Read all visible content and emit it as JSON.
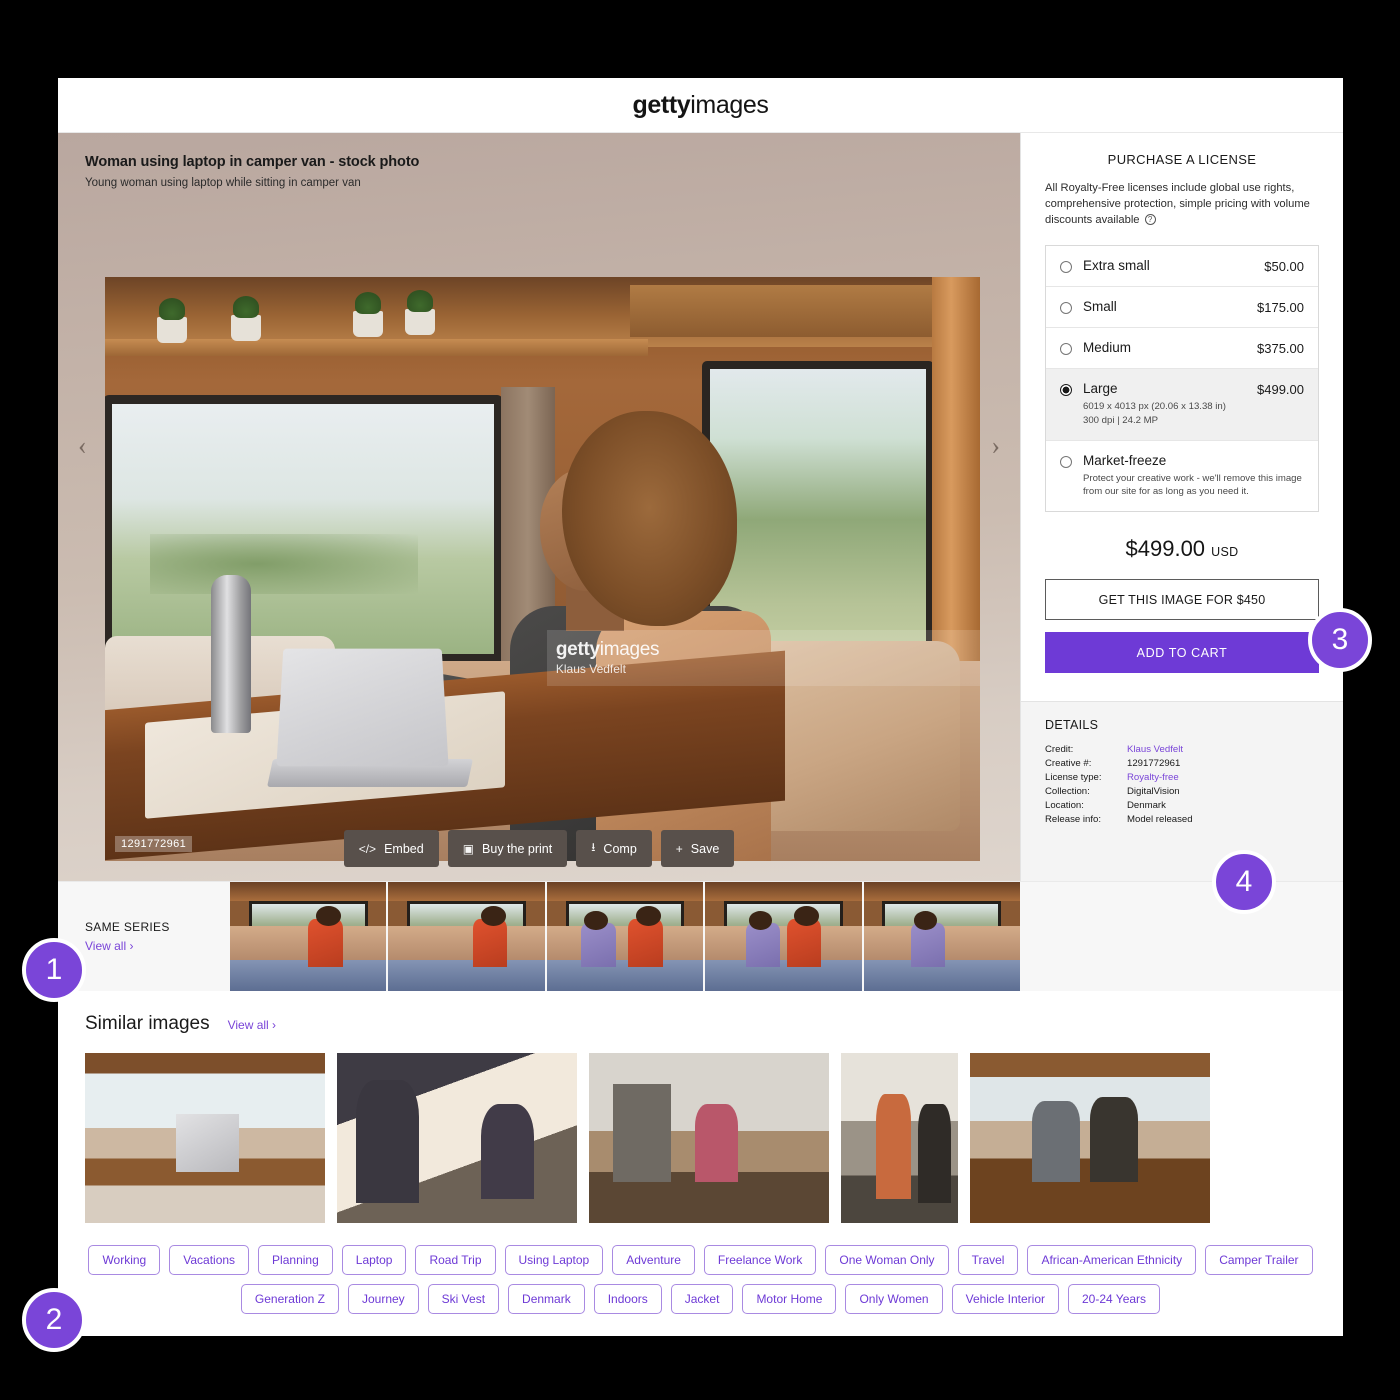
{
  "header": {
    "logo_bold": "getty",
    "logo_light": "images"
  },
  "asset": {
    "title": "Woman using laptop in camper van - stock photo",
    "caption": "Young woman using laptop while sitting in camper van",
    "id": "1291772961",
    "watermark_logo_bold": "getty",
    "watermark_logo_light": "images",
    "watermark_credit": "Klaus Vedfelt",
    "prev_arrow": "‹",
    "next_arrow": "›"
  },
  "toolbar": [
    {
      "icon": "</>",
      "label": "Embed",
      "name": "embed"
    },
    {
      "icon": "▣",
      "label": "Buy the print",
      "name": "buy-the-print"
    },
    {
      "icon": "⭳",
      "label": "Comp",
      "name": "comp"
    },
    {
      "icon": "+",
      "label": "Save",
      "name": "save"
    }
  ],
  "purchase": {
    "heading": "PURCHASE A LICENSE",
    "description": "All Royalty-Free licenses include global use rights, comprehensive protection, simple pricing with volume discounts available",
    "help_icon": "?",
    "options": [
      {
        "name": "Extra small",
        "price": "$50.00",
        "selected": false,
        "sub": ""
      },
      {
        "name": "Small",
        "price": "$175.00",
        "selected": false,
        "sub": ""
      },
      {
        "name": "Medium",
        "price": "$375.00",
        "selected": false,
        "sub": ""
      },
      {
        "name": "Large",
        "price": "$499.00",
        "selected": true,
        "sub": "6019 x 4013 px (20.06 x 13.38 in)\n300 dpi | 24.2 MP"
      },
      {
        "name": "Market-freeze",
        "price": "",
        "selected": false,
        "sub": "Protect your creative work - we'll remove this image from our site for as long as you need it."
      }
    ],
    "total_price": "$499.00",
    "currency": "USD",
    "secondary_button": "GET THIS IMAGE FOR $450",
    "primary_button": "ADD TO CART",
    "accent_color": "#6e3ad6"
  },
  "details": {
    "heading": "DETAILS",
    "rows": [
      {
        "key": "Credit:",
        "value": "Klaus Vedfelt",
        "link": true
      },
      {
        "key": "Creative #:",
        "value": "1291772961",
        "link": false
      },
      {
        "key": "License type:",
        "value": "Royalty-free",
        "link": true
      },
      {
        "key": "Collection:",
        "value": "DigitalVision",
        "link": false
      },
      {
        "key": "Location:",
        "value": "Denmark",
        "link": false
      },
      {
        "key": "Release info:",
        "value": "Model released",
        "link": false
      }
    ]
  },
  "same_series": {
    "title": "SAME SERIES",
    "view_all": "View all ›",
    "thumb_count": 5
  },
  "similar": {
    "title": "Similar images",
    "view_all": "View all ›",
    "card_count": 5
  },
  "keywords": [
    "Working",
    "Vacations",
    "Planning",
    "Laptop",
    "Road Trip",
    "Using Laptop",
    "Adventure",
    "Freelance Work",
    "One Woman Only",
    "Travel",
    "African-American Ethnicity",
    "Camper Trailer",
    "Generation Z",
    "Journey",
    "Ski Vest",
    "Denmark",
    "Indoors",
    "Jacket",
    "Motor Home",
    "Only Women",
    "Vehicle Interior",
    "20-24 Years"
  ],
  "callouts": [
    {
      "number": "1"
    },
    {
      "number": "2"
    },
    {
      "number": "3"
    },
    {
      "number": "4"
    }
  ]
}
